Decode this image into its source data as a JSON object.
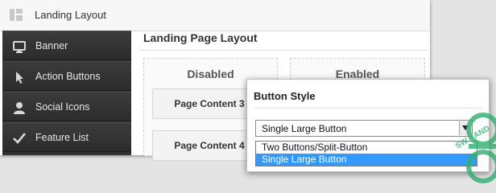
{
  "window": {
    "title": "Landing Layout"
  },
  "sidebar": {
    "items": [
      {
        "label": "Banner",
        "icon": "monitor-icon"
      },
      {
        "label": "Action Buttons",
        "icon": "cursor-arrow-icon"
      },
      {
        "label": "Social Icons",
        "icon": "user-icon"
      },
      {
        "label": "Feature List",
        "icon": "checkmark-icon"
      }
    ]
  },
  "main": {
    "title": "Landing Page Layout",
    "columns": {
      "disabled": {
        "heading": "Disabled",
        "cards": [
          "Page Content 3",
          "Page Content 4"
        ]
      },
      "enabled": {
        "heading": "Enabled"
      }
    }
  },
  "popup": {
    "title": "Button Style",
    "select_value": "Single Large Button",
    "options": [
      "Two Buttons/Split-Button",
      "Single Large Button"
    ],
    "selected_index": 1
  },
  "colors": {
    "sidebar_bg": "#333333",
    "selection_blue": "#3399ff",
    "watermark_green": "#2fae6e"
  }
}
